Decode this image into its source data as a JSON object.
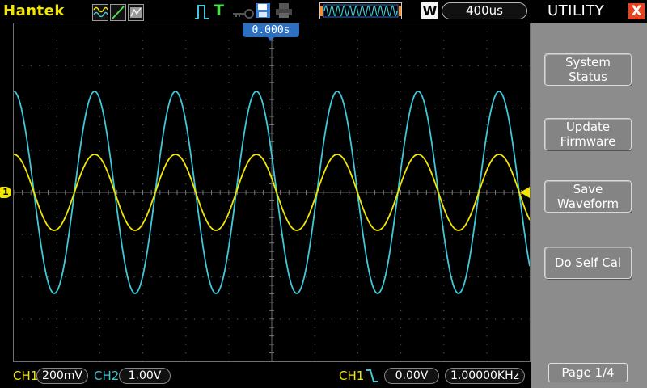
{
  "topbar": {
    "brand": "Hantek",
    "timebase": "400us",
    "waveform_mode_badge": "W",
    "trigger_type_label": "T"
  },
  "plot": {
    "trigger_position": "0.000s",
    "ch1_marker": "1"
  },
  "status": {
    "ch1_label": "CH1",
    "ch1_scale": "200mV",
    "ch2_label": "CH2",
    "ch2_scale": "1.00V",
    "trigger_source": "CH1",
    "trigger_level": "0.00V",
    "frequency": "1.00000KHz"
  },
  "menu": {
    "title": "UTILITY",
    "close_glyph": "X",
    "buttons": [
      {
        "line1": "System",
        "line2": "Status"
      },
      {
        "line1": "Update",
        "line2": "Firmware"
      },
      {
        "line1": "Save",
        "line2": "Waveform"
      },
      {
        "line1": "Do Self Cal",
        "line2": ""
      }
    ],
    "page": "Page 1/4"
  },
  "colors": {
    "ch1": "#f2e600",
    "ch2": "#3ec8d8",
    "accent_blue": "#2d6fc0",
    "panel_gray": "#8c8c8c"
  }
}
